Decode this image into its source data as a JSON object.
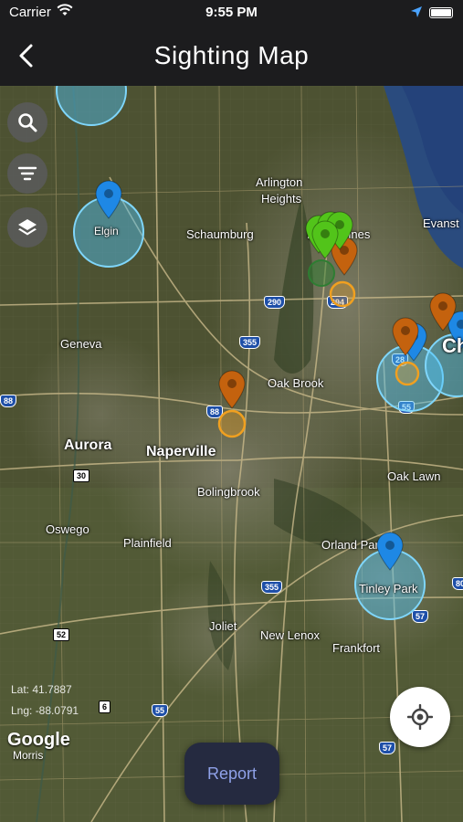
{
  "status_bar": {
    "carrier": "Carrier",
    "time": "9:55 PM"
  },
  "nav": {
    "title": "Sighting Map"
  },
  "map": {
    "labels": {
      "elgin": "Elgin",
      "arlington": "Arlington",
      "heights": "Heights",
      "schaumburg": "Schaumburg",
      "desplaines": "Des Plaines",
      "evanston": "Evanst",
      "geneva": "Geneva",
      "oakbrook": "Oak Brook",
      "aurora": "Aurora",
      "naperville": "Naperville",
      "bolingbrook": "Bolingbrook",
      "oaklawn": "Oak Lawn",
      "oswego": "Oswego",
      "plainfield": "Plainfield",
      "orlandpark": "Orland Park",
      "tinleypark": "Tinley Park",
      "joliet": "Joliet",
      "newlenox": "New Lenox",
      "frankfort": "Frankfort",
      "chicago": "Ch",
      "morris": "Morris"
    },
    "shields": {
      "i290": "290",
      "i294": "294",
      "i355a": "355",
      "i88a": "88",
      "i88b": "88",
      "i55a": "55",
      "i55b": "55",
      "us30": "30",
      "i355b": "355",
      "i57a": "57",
      "i80": "80",
      "us52": "52",
      "us6": "6",
      "i57b": "57",
      "i28": "28"
    },
    "coords": {
      "lat": "Lat: 41.7887",
      "lng": "Lng: -88.0791"
    },
    "attribution": "Google"
  },
  "buttons": {
    "report": "Report"
  },
  "icons": {
    "back": "chevron-left-icon",
    "search": "search-icon",
    "filter": "filter-icon",
    "layers": "layers-icon",
    "locate": "crosshair-icon"
  },
  "colors": {
    "blue_pin": "#1e88e5",
    "orange_pin": "#c4620e",
    "green_pin": "#52c41a",
    "cluster_blue": "#4fc3f7",
    "report_bg": "#252a40",
    "report_text": "#8fa1e8"
  }
}
